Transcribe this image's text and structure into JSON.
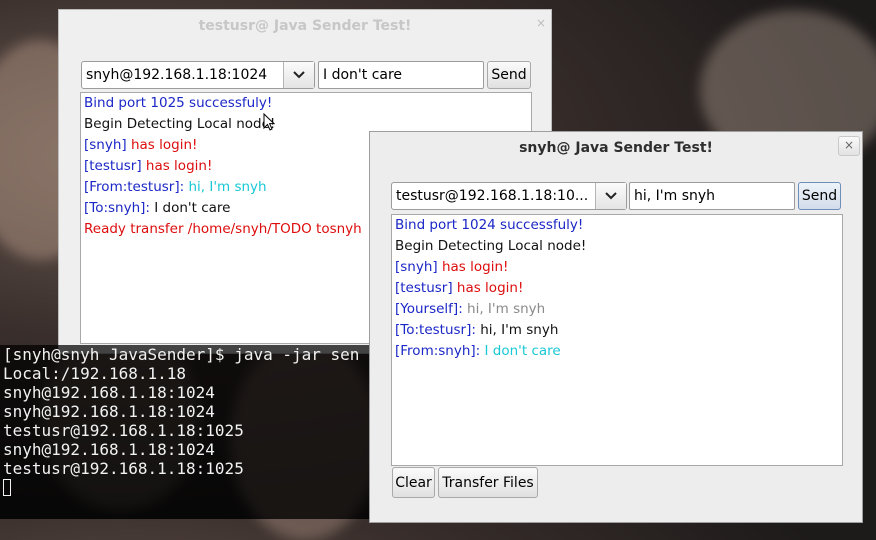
{
  "window_back": {
    "title": "testusr@ Java Sender Test!",
    "close_glyph": "×",
    "target_combo": "snyh@192.168.1.18:1024",
    "message_field": "I don't care",
    "send_label": "Send",
    "log": [
      [
        {
          "t": "Bind port 1025 successfuly!",
          "c": "c-blue"
        }
      ],
      [
        {
          "t": "Begin Detecting Local node!",
          "c": "c-black"
        }
      ],
      [
        {
          "t": "[snyh]",
          "c": "c-blue"
        },
        {
          "t": " has login!",
          "c": "c-red"
        }
      ],
      [
        {
          "t": "[testusr]",
          "c": "c-blue"
        },
        {
          "t": " has login!",
          "c": "c-red"
        }
      ],
      [
        {
          "t": "[From:testusr]:",
          "c": "c-blue"
        },
        {
          "t": " hi, I'm snyh",
          "c": "c-cyan"
        }
      ],
      [
        {
          "t": "[To:snyh]:",
          "c": "c-blue"
        },
        {
          "t": " I don't care",
          "c": "c-black"
        }
      ],
      [
        {
          "t": "Ready transfer /home/snyh/TODO tosnyh",
          "c": "c-red"
        }
      ]
    ]
  },
  "window_front": {
    "title": "snyh@ Java Sender Test!",
    "close_glyph": "×",
    "target_combo": "testusr@192.168.1.18:10...",
    "message_field": "hi, I'm snyh",
    "send_label": "Send",
    "clear_label": "Clear",
    "transfer_label": "Transfer Files",
    "log": [
      [
        {
          "t": "Bind port 1024 successfuly!",
          "c": "c-blue"
        }
      ],
      [
        {
          "t": "Begin Detecting Local node!",
          "c": "c-black"
        }
      ],
      [
        {
          "t": "[snyh]",
          "c": "c-blue"
        },
        {
          "t": " has login!",
          "c": "c-red"
        }
      ],
      [
        {
          "t": "[testusr]",
          "c": "c-blue"
        },
        {
          "t": " has login!",
          "c": "c-red"
        }
      ],
      [
        {
          "t": "[Yourself]:",
          "c": "c-blue"
        },
        {
          "t": " hi, I'm snyh",
          "c": "c-gray"
        }
      ],
      [
        {
          "t": "[To:testusr]:",
          "c": "c-blue"
        },
        {
          "t": " hi, I'm snyh",
          "c": "c-black"
        }
      ],
      [
        {
          "t": "[From:snyh]:",
          "c": "c-blue"
        },
        {
          "t": " I don't care",
          "c": "c-cyan"
        }
      ]
    ]
  },
  "terminal": {
    "lines": [
      "[snyh@snyh JavaSender]$ java -jar sen",
      "Local:/192.168.1.18",
      "snyh@192.168.1.18:1024",
      "snyh@192.168.1.18:1024",
      "testusr@192.168.1.18:1025",
      "snyh@192.168.1.18:1024",
      "testusr@192.168.1.18:1025"
    ]
  }
}
